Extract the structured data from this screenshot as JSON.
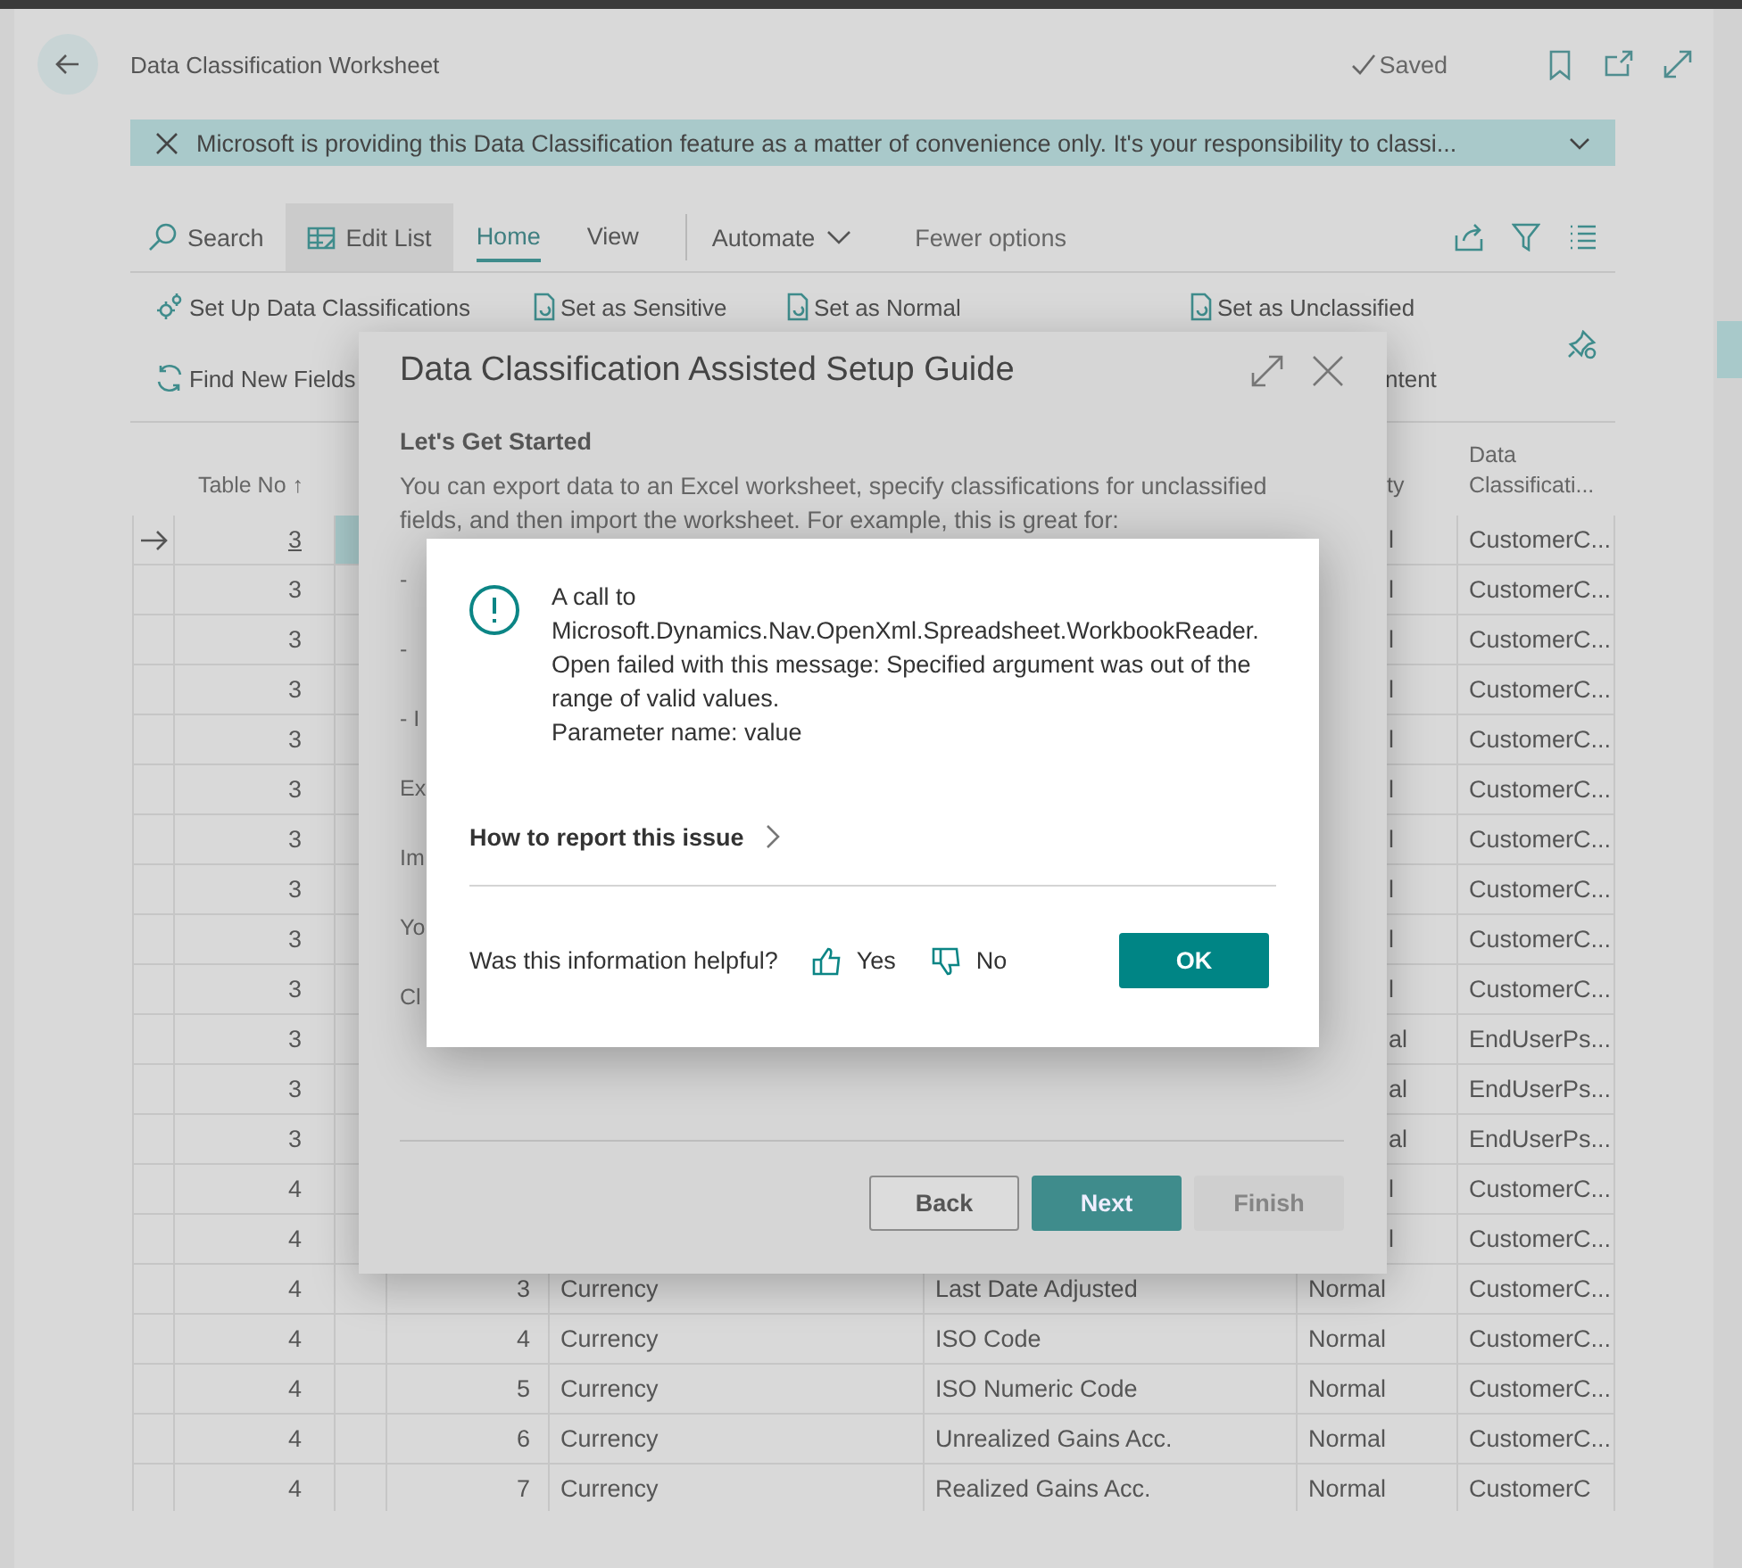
{
  "header": {
    "title": "Data Classification Worksheet",
    "status": "Saved"
  },
  "banner": {
    "text": "Microsoft is providing this Data Classification feature as a matter of convenience only. It's your responsibility to classi..."
  },
  "action_bar": {
    "search": "Search",
    "edit_list": "Edit List",
    "tabs": [
      {
        "label": "Home",
        "selected": true
      },
      {
        "label": "View",
        "selected": false
      }
    ],
    "automate": "Automate",
    "fewer_options": "Fewer options"
  },
  "actions": [
    [
      {
        "label": "Set Up Data Classifications",
        "kind": "setup"
      },
      {
        "label": "Set as Sensitive",
        "kind": "set"
      },
      {
        "label": "Set as Normal",
        "kind": "set"
      },
      {
        "label": "Set as Unclassified",
        "kind": "set"
      }
    ],
    [
      {
        "label": "Find New Fields",
        "kind": "refresh"
      },
      {
        "label": "ntent",
        "kind": "plain"
      }
    ]
  ],
  "table": {
    "columns": [
      {
        "label": "Table No ↑"
      },
      {
        "label": "ty"
      },
      {
        "label": "Data Classificati..."
      }
    ],
    "rows": [
      {
        "selected": true,
        "table_no": "3",
        "data_sensitivity": "l",
        "data_classification": "CustomerC..."
      },
      {
        "selected": false,
        "table_no": "3",
        "data_sensitivity": "l",
        "data_classification": "CustomerC..."
      },
      {
        "selected": false,
        "table_no": "3",
        "data_sensitivity": "l",
        "data_classification": "CustomerC..."
      },
      {
        "selected": false,
        "table_no": "3",
        "data_sensitivity": "l",
        "data_classification": "CustomerC..."
      },
      {
        "selected": false,
        "table_no": "3",
        "data_sensitivity": "l",
        "data_classification": "CustomerC..."
      },
      {
        "selected": false,
        "table_no": "3",
        "data_sensitivity": "l",
        "data_classification": "CustomerC..."
      },
      {
        "selected": false,
        "table_no": "3",
        "data_sensitivity": "l",
        "data_classification": "CustomerC..."
      },
      {
        "selected": false,
        "table_no": "3",
        "data_sensitivity": "l",
        "data_classification": "CustomerC..."
      },
      {
        "selected": false,
        "table_no": "3",
        "data_sensitivity": "l",
        "data_classification": "CustomerC..."
      },
      {
        "selected": false,
        "table_no": "3",
        "data_sensitivity": "l",
        "data_classification": "CustomerC..."
      },
      {
        "selected": false,
        "table_no": "3",
        "data_sensitivity": "al",
        "data_classification": "EndUserPs..."
      },
      {
        "selected": false,
        "table_no": "3",
        "data_sensitivity": "al",
        "data_classification": "EndUserPs..."
      },
      {
        "selected": false,
        "table_no": "3",
        "data_sensitivity": "al",
        "data_classification": "EndUserPs..."
      },
      {
        "selected": false,
        "table_no": "4",
        "data_sensitivity": "l",
        "data_classification": "CustomerC..."
      },
      {
        "selected": false,
        "table_no": "4",
        "data_sensitivity": "l",
        "data_classification": "CustomerC..."
      },
      {
        "selected": false,
        "table_no": "4",
        "field_no": "3",
        "table_name": "Currency",
        "field_name": "Last Date Adjusted",
        "data_sensitivity": "Normal",
        "data_classification": "CustomerC..."
      },
      {
        "selected": false,
        "table_no": "4",
        "field_no": "4",
        "table_name": "Currency",
        "field_name": "ISO Code",
        "data_sensitivity": "Normal",
        "data_classification": "CustomerC..."
      },
      {
        "selected": false,
        "table_no": "4",
        "field_no": "5",
        "table_name": "Currency",
        "field_name": "ISO Numeric Code",
        "data_sensitivity": "Normal",
        "data_classification": "CustomerC..."
      },
      {
        "selected": false,
        "table_no": "4",
        "field_no": "6",
        "table_name": "Currency",
        "field_name": "Unrealized Gains Acc.",
        "data_sensitivity": "Normal",
        "data_classification": "CustomerC..."
      },
      {
        "selected": false,
        "table_no": "4",
        "field_no": "7",
        "table_name": "Currency",
        "field_name": "Realized Gains Acc.",
        "data_sensitivity": "Normal",
        "data_classification": "CustomerC"
      }
    ]
  },
  "wizard": {
    "title": "Data Classification Assisted Setup Guide",
    "heading": "Let's Get Started",
    "intro": "You can export data to an Excel worksheet, specify classifications for unclassified fields, and then import the worksheet. For example, this is great for:",
    "fragments": [
      "-",
      "-",
      "- I",
      "Ex",
      "Im",
      "Yo",
      "Cl"
    ],
    "buttons": [
      {
        "label": "Back",
        "kind": "secondary",
        "disabled": false
      },
      {
        "label": "Next",
        "kind": "primary",
        "disabled": false
      },
      {
        "label": "Finish",
        "kind": "secondary",
        "disabled": true
      }
    ]
  },
  "error_dialog": {
    "message": [
      "A call to Microsoft.Dynamics.Nav.OpenXml.Spreadsheet.WorkbookReader. Open failed with this message: Specified argument was out of the range of valid values.",
      "Parameter name: value"
    ],
    "report_link": "How to report this issue",
    "feedback_question": "Was this information helpful?",
    "yes": "Yes",
    "no": "No",
    "ok": "OK"
  }
}
